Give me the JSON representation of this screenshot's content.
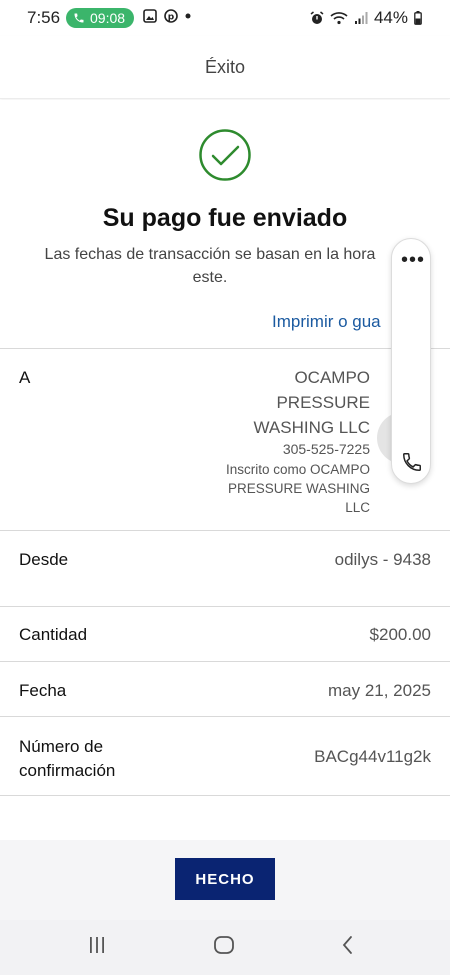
{
  "status_bar": {
    "time": "7:56",
    "call_timer": "09:08",
    "battery": "44%"
  },
  "header": {
    "title": "Éxito"
  },
  "success": {
    "title": "Su pago fue enviado",
    "subtitle": "Las fechas de transacción se basan en la hora este.",
    "print_link": "Imprimir o gua"
  },
  "details": {
    "recipient_label": "A",
    "recipient_name_lines": [
      "OCAMPO",
      "PRESSURE",
      "WASHING LLC"
    ],
    "recipient_phone": "305-525-7225",
    "recipient_registered_lines": [
      "Inscrito como OCAMPO",
      "PRESSURE WASHING",
      "LLC"
    ],
    "from_label": "Desde",
    "from_value": "odilys - 9438",
    "amount_label": "Cantidad",
    "amount_value": "$200.00",
    "date_label": "Fecha",
    "date_value": "may 21, 2025",
    "confirmation_label_lines": [
      "Número de",
      "confirmación"
    ],
    "confirmation_value": "BACg44v11g2k"
  },
  "actions": {
    "done_label": "HECHO"
  },
  "floating_panel": {
    "more_icon": "more-dots-icon",
    "call_icon": "phone-icon"
  },
  "colors": {
    "accent_green": "#3bb56b",
    "link_blue": "#1b5aa0",
    "primary_button": "#0a2472",
    "check_green": "#2e8b2e"
  }
}
